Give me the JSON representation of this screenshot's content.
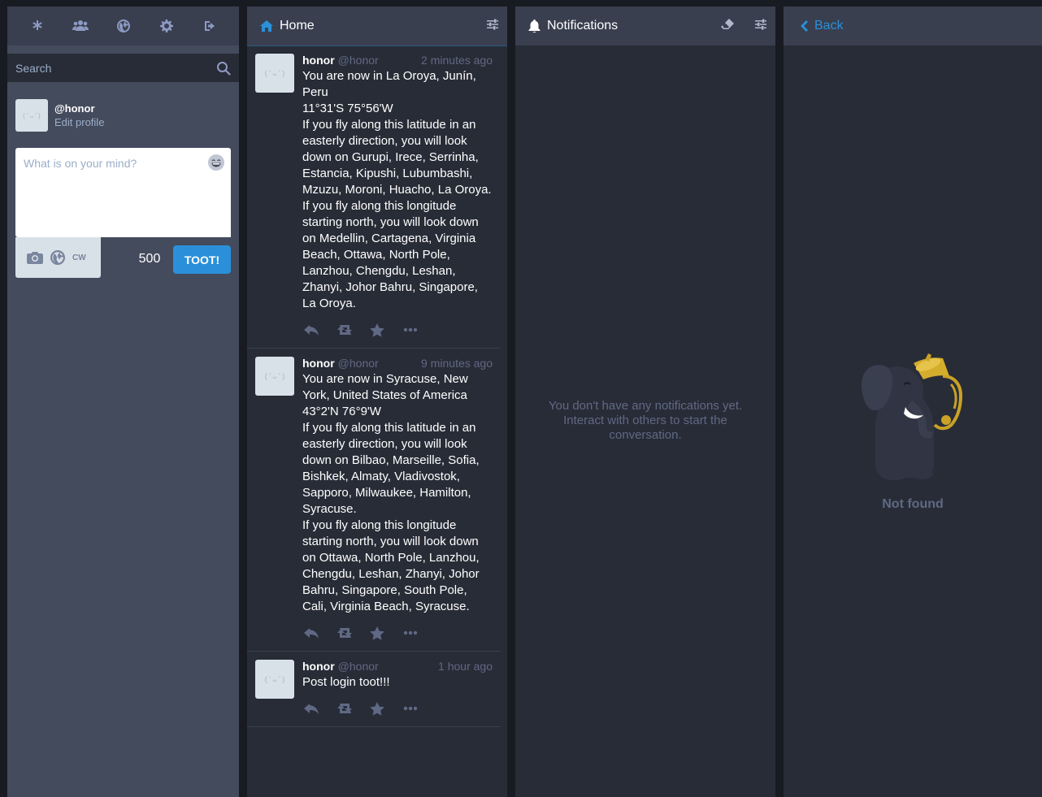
{
  "drawer": {
    "tabs": [
      {
        "icon": "getting-started-icon"
      },
      {
        "icon": "local-timeline-icon"
      },
      {
        "icon": "federated-timeline-icon"
      },
      {
        "icon": "preferences-icon"
      },
      {
        "icon": "logout-icon"
      }
    ],
    "search": {
      "placeholder": "Search"
    },
    "account": {
      "handle": "@honor",
      "edit_label": "Edit profile",
      "avatar_glyph": "( ' ᴗ ' )"
    },
    "compose": {
      "placeholder": "What is on your mind?",
      "cw_label": "CW",
      "char_count": "500",
      "submit_label": "TOOT!"
    }
  },
  "home": {
    "title": "Home",
    "statuses": [
      {
        "name": "honor",
        "acct": "@honor",
        "time": "2 minutes ago",
        "lines": [
          "You are now in La Oroya, Junín, Peru",
          "11°31'S 75°56'W",
          "If you fly along this latitude in an easterly direction, you will look down on Gurupi, Irece, Serrinha, Estancia, Kipushi, Lubumbashi, Mzuzu, Moroni, Huacho, La Oroya.",
          "If you fly along this longitude starting north, you will look down on Medellin, Cartagena, Virginia Beach, Ottawa, North Pole, Lanzhou, Chengdu, Leshan, Zhanyi, Johor Bahru, Singapore, La Oroya."
        ]
      },
      {
        "name": "honor",
        "acct": "@honor",
        "time": "9 minutes ago",
        "lines": [
          "You are now in Syracuse, New York, United States of America",
          "43°2'N 76°9'W",
          "If you fly along this latitude in an easterly direction, you will look down on Bilbao, Marseille, Sofia, Bishkek, Almaty, Vladivostok, Sapporo, Milwaukee, Hamilton, Syracuse.",
          "If you fly along this longitude starting north, you will look down on Ottawa, North Pole, Lanzhou, Chengdu, Leshan, Zhanyi, Johor Bahru, Singapore, South Pole, Cali, Virginia Beach, Syracuse."
        ]
      },
      {
        "name": "honor",
        "acct": "@honor",
        "time": "1 hour ago",
        "lines": [
          "Post login toot!!!"
        ]
      }
    ]
  },
  "notifications": {
    "title": "Notifications",
    "empty_message": "You don't have any notifications yet. Interact with others to start the conversation."
  },
  "detail": {
    "back_label": "Back",
    "not_found_label": "Not found"
  },
  "colors": {
    "accent": "#2b90d9",
    "background": "#191b22",
    "column": "#282c37",
    "header": "#393f4f",
    "drawer": "#444b5d"
  }
}
